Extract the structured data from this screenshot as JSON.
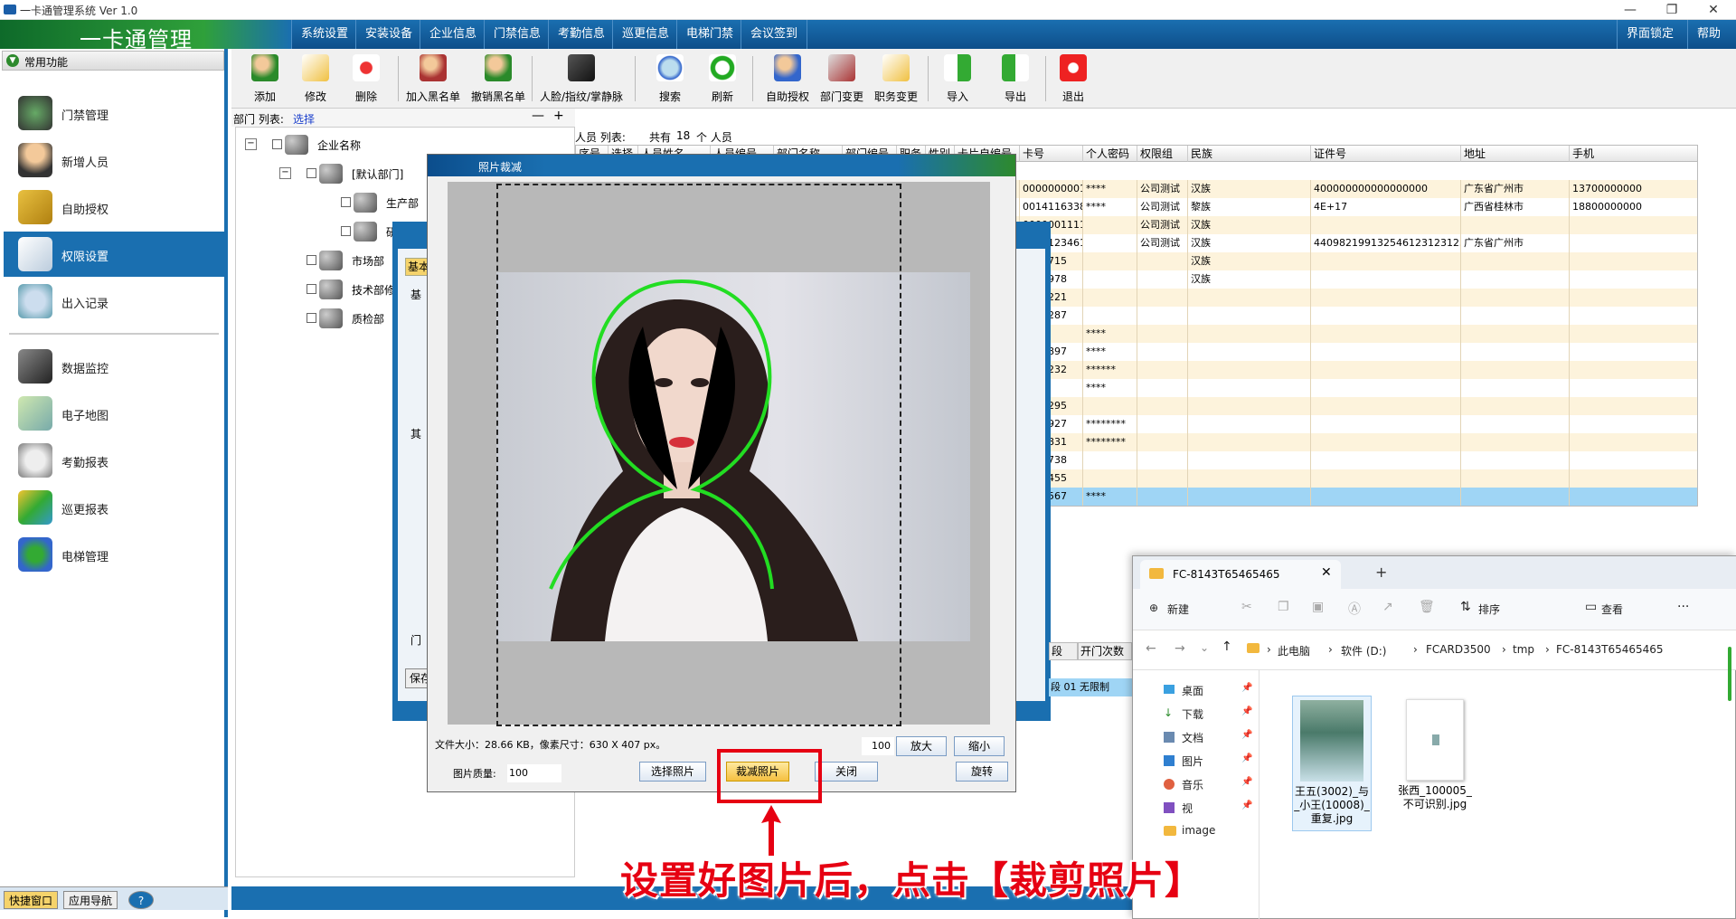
{
  "window": {
    "title": "一卡通管理系统 Ver 1.0"
  },
  "app": {
    "logo": "一卡通管理",
    "menus": [
      "系统设置",
      "安装设备",
      "企业信息",
      "门禁信息",
      "考勤信息",
      "巡更信息",
      "电梯门禁",
      "会议签到"
    ],
    "lock": "界面锁定",
    "help": "帮助"
  },
  "sidebar": {
    "header": "常用功能",
    "items": [
      "门禁管理",
      "新增人员",
      "自助授权",
      "权限设置",
      "出入记录",
      "数据监控",
      "电子地图",
      "考勤报表",
      "巡更报表",
      "电梯管理"
    ],
    "selected": "权限设置",
    "footer": [
      "快捷窗口",
      "应用导航",
      "?"
    ]
  },
  "toolbar": {
    "buttons": [
      "添加",
      "修改",
      "删除",
      "加入黑名单",
      "撤销黑名单",
      "人脸/指纹/掌静脉",
      "搜索",
      "刷新",
      "自助授权",
      "部门变更",
      "职务变更",
      "导入",
      "导出",
      "退出"
    ]
  },
  "dept": {
    "label": "部门 列表:",
    "select": "选择",
    "minus": "—",
    "plus": "+"
  },
  "tree": {
    "root": "企业名称",
    "nodes": [
      "[默认部门]",
      "生产部",
      "研",
      "市场部",
      "技术部修",
      "质检部"
    ]
  },
  "list": {
    "label": "人员 列表:",
    "count_prefix": "共有",
    "count": "18",
    "count_suffix": "个 人员"
  },
  "grid": {
    "columns": [
      "序号",
      "选择",
      "人员姓名",
      "人员编号",
      "部门名称",
      "部门编号",
      "职务",
      "性别",
      "卡片自编号",
      "卡号",
      "个人密码",
      "权限组",
      "民族",
      "证件号",
      "地址",
      "手机"
    ],
    "rows": [
      [
        "0000000001",
        "****",
        "公司测试",
        "汉族",
        "400000000000000000",
        "广东省广州市",
        "13700000000"
      ],
      [
        "0014116338",
        "****",
        "公司测试",
        "黎族",
        "4E+17",
        "广西省桂林市",
        "18800000000"
      ],
      [
        "0000001111",
        "",
        "公司测试",
        "汉族",
        "",
        "",
        ""
      ],
      [
        "3115123461",
        "",
        "公司测试",
        "汉族",
        "440982199132546123123123",
        "广东省广州市",
        ""
      ],
      [
        "2081715",
        "",
        "",
        "汉族",
        "",
        "",
        ""
      ],
      [
        "0009978",
        "",
        "",
        "汉族",
        "",
        "",
        ""
      ],
      [
        "4351221",
        "",
        "",
        "",
        "",
        "",
        ""
      ],
      [
        "2311287",
        "",
        "",
        "",
        "",
        "",
        ""
      ],
      [
        "",
        "****",
        "",
        "",
        "",
        "",
        ""
      ],
      [
        "0016897",
        "****",
        "",
        "",
        "",
        "",
        ""
      ],
      [
        "0003232",
        "******",
        "",
        "",
        "",
        "",
        ""
      ],
      [
        "",
        "****",
        "",
        "",
        "",
        "",
        ""
      ],
      [
        "1354295",
        "",
        "",
        "",
        "",
        "",
        ""
      ],
      [
        "0933927",
        "********",
        "",
        "",
        "",
        "",
        ""
      ],
      [
        "1009831",
        "********",
        "",
        "",
        "",
        "",
        ""
      ],
      [
        "5501738",
        "",
        "",
        "",
        "",
        "",
        ""
      ],
      [
        "2370455",
        "",
        "",
        "",
        "",
        "",
        ""
      ],
      [
        "1234567",
        "****",
        "",
        "",
        "",
        "",
        ""
      ]
    ]
  },
  "bgdialog": {
    "tab": "基本",
    "save": "保存",
    "label1": "基",
    "label2": "其",
    "label3": "门"
  },
  "lowgrid": {
    "col1": "段",
    "col2": "开门次数",
    "val1": "段 01",
    "val2": "无限制"
  },
  "crop": {
    "title": "照片裁减",
    "file_info": "文件大小：28.66 KB，像素尺寸：630 X 407 px。",
    "zoom_value": "100",
    "zoom_in": "放大",
    "zoom_out": "缩小",
    "quality_label": "图片质量:",
    "quality_value": "100",
    "select": "选择照片",
    "crop": "裁减照片",
    "close": "关闭",
    "rotate": "旋转"
  },
  "explorer": {
    "tab": "FC-8143T65465465",
    "new": "新建",
    "sort": "排序",
    "view": "查看",
    "more": "···",
    "path": [
      "此电脑",
      "软件 (D:)",
      "FCARD3500",
      "tmp",
      "FC-8143T65465465"
    ],
    "side": [
      "桌面",
      "下载",
      "文档",
      "图片",
      "音乐",
      "视",
      "image"
    ],
    "files": [
      {
        "name": "王五(3002)_与_小王(10008)_重复.jpg"
      },
      {
        "name": "张西_100005_不可识别.jpg"
      }
    ]
  },
  "annotation": {
    "text": "设置好图片后，点击【裁剪照片】"
  },
  "colors": {
    "accent": "#1a6fb0",
    "highlight": "#e60012",
    "row_alt": "#fdf3dc",
    "row_sel": "#9fd5f5"
  }
}
